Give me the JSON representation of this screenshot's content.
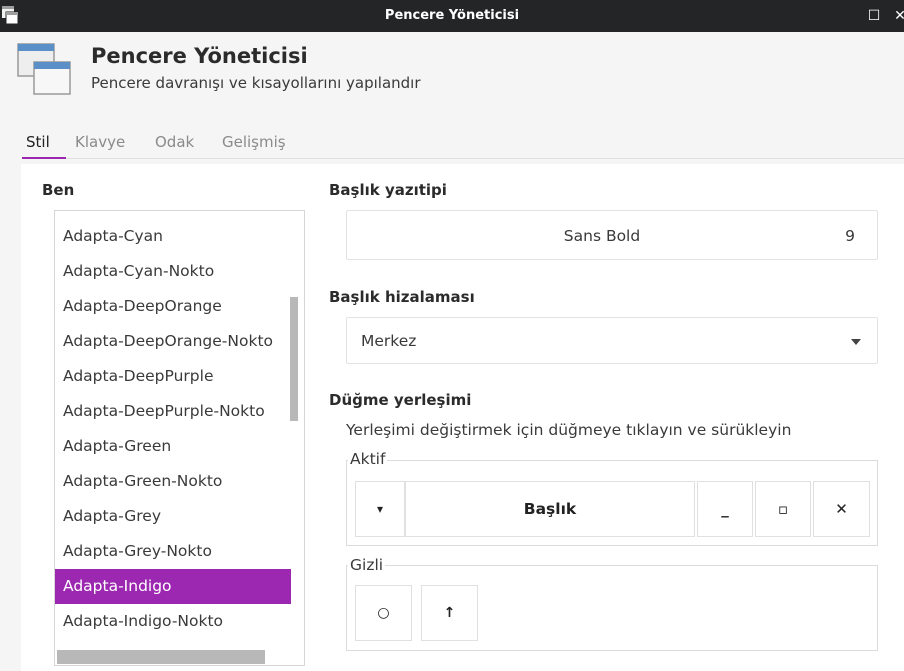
{
  "window": {
    "title": "Pencere Yöneticisi",
    "maximize_glyph": "☐",
    "close_glyph": "✕"
  },
  "header": {
    "title": "Pencere Yöneticisi",
    "subtitle": "Pencere davranışı ve kısayollarını yapılandır",
    "icon": "window-manager-icon"
  },
  "tabs": [
    {
      "label": "Stil",
      "active": true
    },
    {
      "label": "Klavye",
      "active": false
    },
    {
      "label": "Odak",
      "active": false
    },
    {
      "label": "Gelişmiş",
      "active": false
    }
  ],
  "theme_section": {
    "label": "Ben",
    "items": [
      "Adapta-Cyan",
      "Adapta-Cyan-Nokto",
      "Adapta-DeepOrange",
      "Adapta-DeepOrange-Nokto",
      "Adapta-DeepPurple",
      "Adapta-DeepPurple-Nokto",
      "Adapta-Green",
      "Adapta-Green-Nokto",
      "Adapta-Grey",
      "Adapta-Grey-Nokto",
      "Adapta-Indigo",
      "Adapta-Indigo-Nokto"
    ],
    "selected": "Adapta-Indigo"
  },
  "title_font": {
    "label": "Başlık yazıtipi",
    "font_name": "Sans Bold",
    "font_size": "9"
  },
  "title_alignment": {
    "label": "Başlık hizalaması",
    "value": "Merkez"
  },
  "button_layout": {
    "label": "Düğme yerleşimi",
    "hint": "Yerleşimi değiştirmek için düğmeye tıklayın ve sürükleyin",
    "active_label": "Aktif",
    "active_buttons": {
      "menu": "▾",
      "title": "Başlık",
      "minimize": "_",
      "maximize": "▫",
      "close": "✕"
    },
    "hidden_label": "Gizli",
    "hidden_buttons": {
      "stick": "○",
      "shade": "↑"
    }
  },
  "colors": {
    "accent": "#9c27b0",
    "titlebar": "#232527",
    "background": "#ffffff"
  }
}
